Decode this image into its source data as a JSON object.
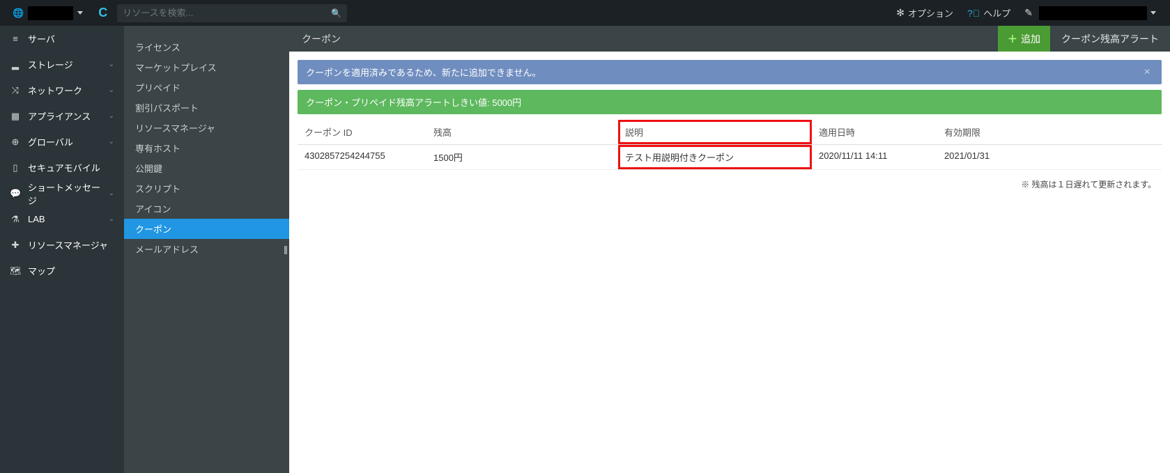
{
  "topbar": {
    "search_placeholder": "リソースを検索...",
    "options_label": "オプション",
    "help_label": "ヘルプ"
  },
  "nav1": [
    {
      "icon": "server",
      "label": "サーバ",
      "chevron": false
    },
    {
      "icon": "storage",
      "label": "ストレージ",
      "chevron": true
    },
    {
      "icon": "network",
      "label": "ネットワーク",
      "chevron": true
    },
    {
      "icon": "appliance",
      "label": "アプライアンス",
      "chevron": true
    },
    {
      "icon": "global",
      "label": "グローバル",
      "chevron": true
    },
    {
      "icon": "mobile",
      "label": "セキュアモバイル",
      "chevron": false
    },
    {
      "icon": "message",
      "label": "ショートメッセージ",
      "chevron": true
    },
    {
      "icon": "lab",
      "label": "LAB",
      "chevron": true
    },
    {
      "icon": "resourcemgr",
      "label": "リソースマネージャ",
      "chevron": false
    },
    {
      "icon": "map",
      "label": "マップ",
      "chevron": false
    }
  ],
  "nav2": {
    "items": [
      "ライセンス",
      "マーケットプレイス",
      "プリペイド",
      "割引パスポート",
      "リソースマネージャ",
      "専有ホスト",
      "公開鍵",
      "スクリプト",
      "アイコン",
      "クーポン",
      "メールアドレス"
    ],
    "active_index": 9
  },
  "content": {
    "title": "クーポン",
    "add_label": "追加",
    "alert_button_label": "クーポン残高アラート",
    "info_alert": "クーポンを適用済みであるため、新たに追加できません。",
    "threshold_alert": "クーポン・プリペイド残高アラートしきい値: 5000円",
    "table": {
      "headers": {
        "id": "クーポン ID",
        "balance": "残高",
        "description": "説明",
        "applied_at": "適用日時",
        "expires": "有効期限"
      },
      "row": {
        "id": "4302857254244755",
        "balance": "1500円",
        "description": "テスト用説明付きクーポン",
        "applied_at": "2020/11/11 14:11",
        "expires": "2021/01/31"
      }
    },
    "note": "※ 残高は１日遅れて更新されます。"
  },
  "icons": {
    "server": "≡",
    "storage": "▂",
    "network": "⤨",
    "appliance": "▦",
    "global": "⊕",
    "mobile": "▯",
    "message": "💬",
    "lab": "⚗",
    "resourcemgr": "✚",
    "map": "🗺"
  }
}
